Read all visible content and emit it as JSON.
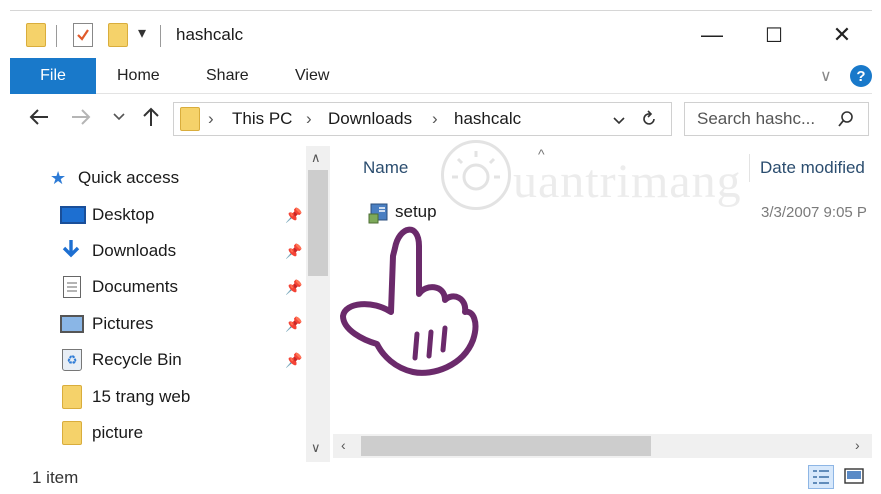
{
  "titlebar": {
    "title": "hashcalc",
    "minimize": "—",
    "maximize": "☐",
    "close": "✕"
  },
  "ribbon": {
    "tabs": [
      "File",
      "Home",
      "Share",
      "View"
    ],
    "help": "?",
    "collapse": "∨"
  },
  "address": {
    "crumbs": [
      "This PC",
      "Downloads",
      "hashcalc"
    ],
    "search_placeholder": "Search hashc..."
  },
  "nav": {
    "quick_access": "Quick access",
    "items": [
      {
        "label": "Desktop",
        "icon": "desktop-icon",
        "pinned": true
      },
      {
        "label": "Downloads",
        "icon": "download-arrow-icon",
        "pinned": true
      },
      {
        "label": "Documents",
        "icon": "documents-icon",
        "pinned": true
      },
      {
        "label": "Pictures",
        "icon": "pictures-icon",
        "pinned": true
      },
      {
        "label": "Recycle Bin",
        "icon": "recycle-bin-icon",
        "pinned": true
      },
      {
        "label": "15 trang web",
        "icon": "folder-icon",
        "pinned": false
      },
      {
        "label": "picture",
        "icon": "folder-icon",
        "pinned": false
      }
    ]
  },
  "content": {
    "columns": {
      "name": "Name",
      "date": "Date modified"
    },
    "files": [
      {
        "name": "setup",
        "date": "3/3/2007 9:05 P"
      }
    ]
  },
  "status": {
    "count": "1 item"
  },
  "watermark": {
    "text": "uantrimang"
  },
  "colors": {
    "accent": "#1979ca",
    "folder": "#f5d26a",
    "hand": "#6b2a6b"
  }
}
